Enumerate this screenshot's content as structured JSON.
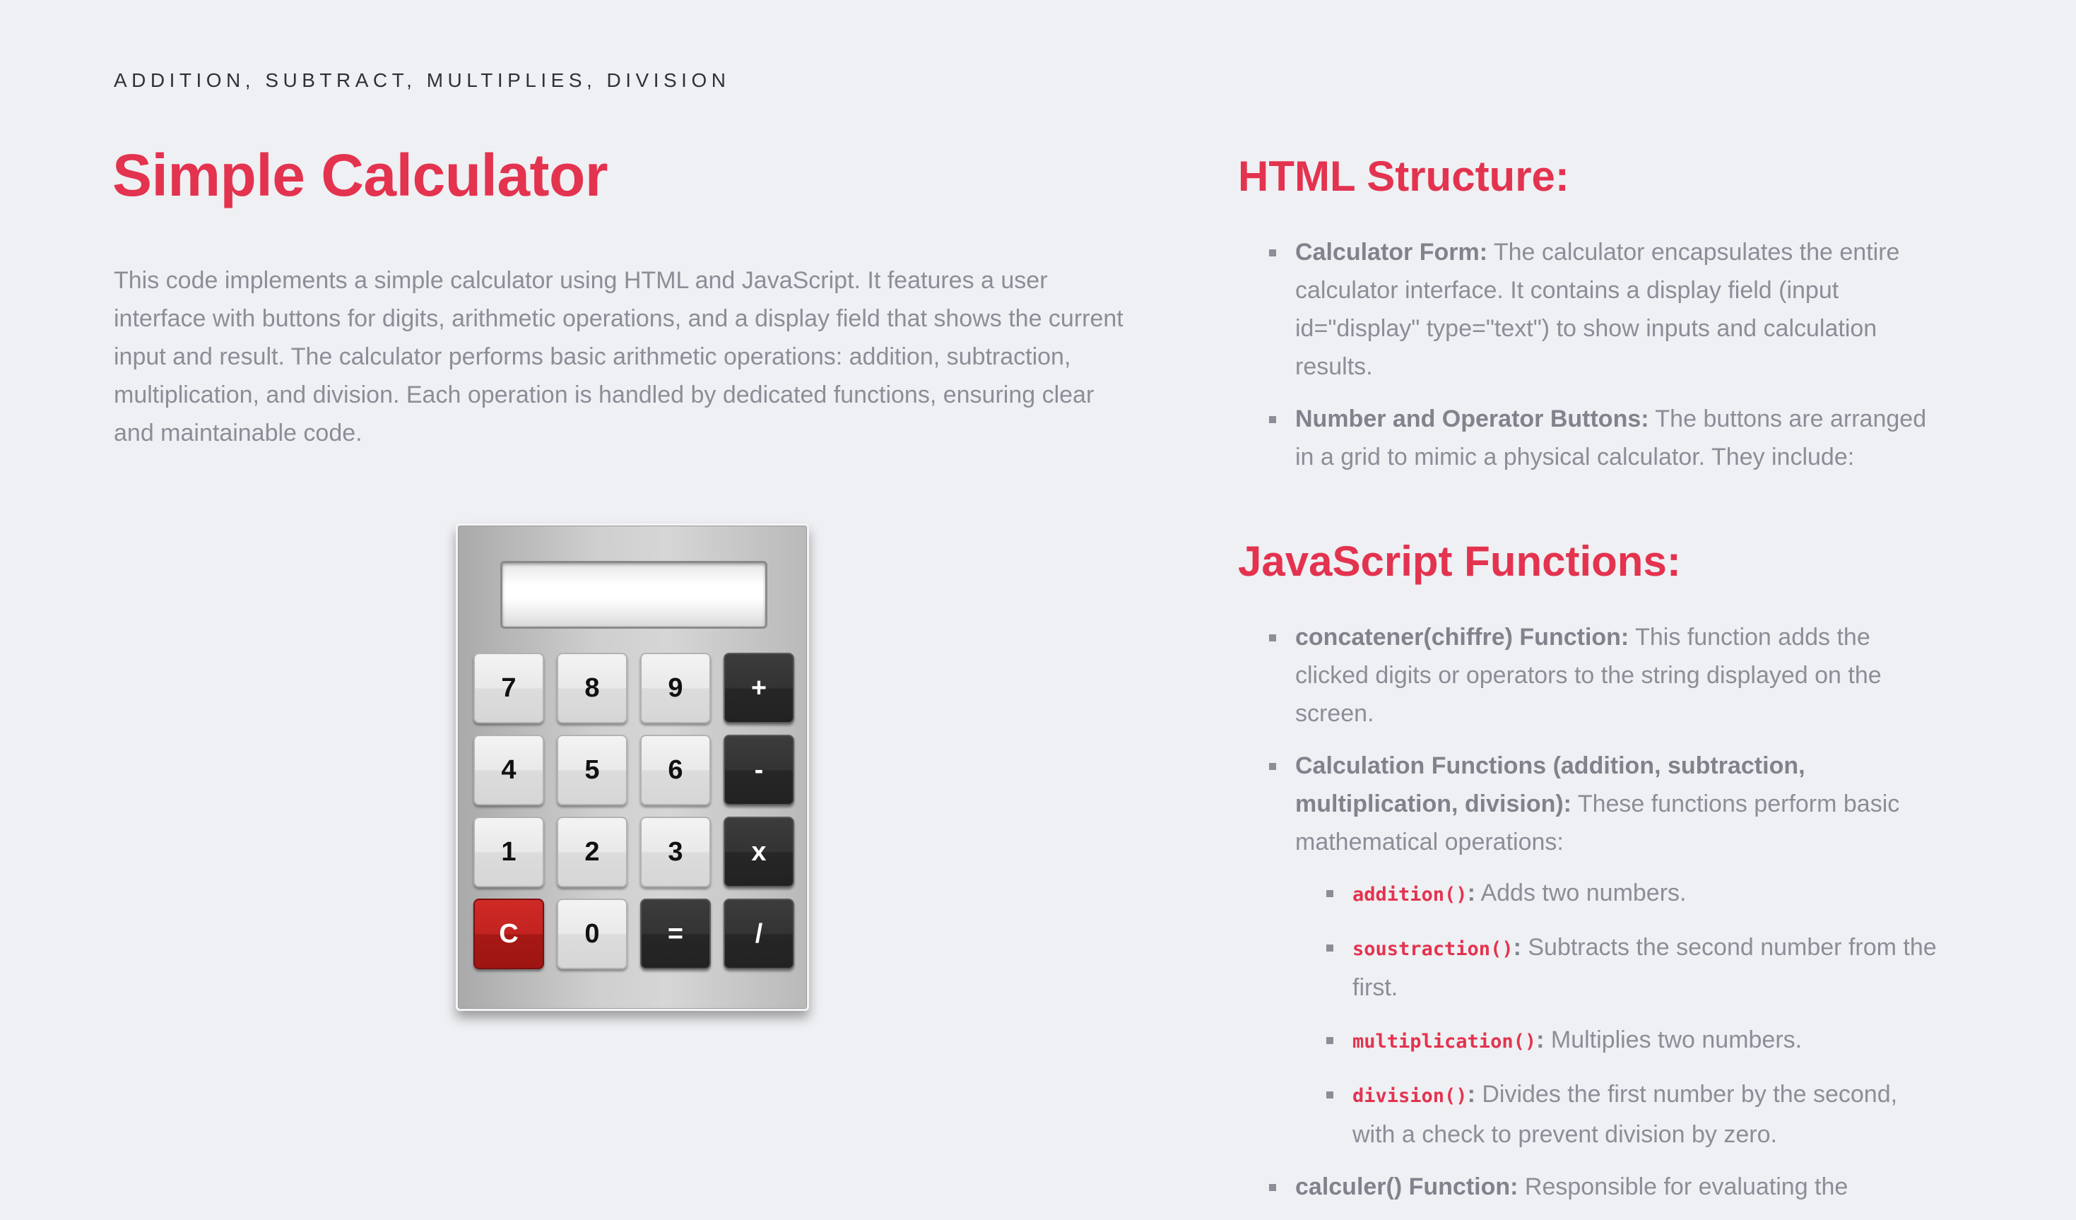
{
  "eyebrow": "ADDITION, SUBTRACT, MULTIPLIES, DIVISION",
  "title": "Simple Calculator",
  "intro": "This code implements a simple calculator using HTML and JavaScript. It features a user interface with buttons for digits, arithmetic operations, and a display field that shows the current input and result. The calculator performs basic arithmetic operations: addition, subtraction, multiplication, and division. Each operation is handled by dedicated functions, ensuring clear and maintainable code.",
  "calculator": {
    "display_value": "",
    "keys": [
      {
        "label": "7",
        "style": "light",
        "name": "key-7"
      },
      {
        "label": "8",
        "style": "light",
        "name": "key-8"
      },
      {
        "label": "9",
        "style": "light",
        "name": "key-9"
      },
      {
        "label": "+",
        "style": "dark",
        "name": "key-plus"
      },
      {
        "label": "4",
        "style": "light",
        "name": "key-4"
      },
      {
        "label": "5",
        "style": "light",
        "name": "key-5"
      },
      {
        "label": "6",
        "style": "light",
        "name": "key-6"
      },
      {
        "label": "-",
        "style": "dark",
        "name": "key-minus"
      },
      {
        "label": "1",
        "style": "light",
        "name": "key-1"
      },
      {
        "label": "2",
        "style": "light",
        "name": "key-2"
      },
      {
        "label": "3",
        "style": "light",
        "name": "key-3"
      },
      {
        "label": "x",
        "style": "dark",
        "name": "key-multiply"
      },
      {
        "label": "C",
        "style": "red",
        "name": "key-clear"
      },
      {
        "label": "0",
        "style": "light",
        "name": "key-0"
      },
      {
        "label": "=",
        "style": "dark",
        "name": "key-equals"
      },
      {
        "label": "/",
        "style": "dark",
        "name": "key-divide"
      }
    ]
  },
  "html_structure": {
    "title": "HTML Structure:",
    "items": [
      {
        "label": "Calculator Form:",
        "text": " The calculator encapsulates the entire calculator interface. It contains a display field (input id=\"display\" type=\"text\") to show inputs and calculation results."
      },
      {
        "label": "Number and Operator Buttons:",
        "text": " The buttons are arranged in a grid to mimic a physical calculator. They include:"
      }
    ]
  },
  "js_functions": {
    "title": "JavaScript Functions:",
    "items": [
      {
        "label": "concatener(chiffre) Function:",
        "text": " This function adds the clicked digits or operators to the string displayed on the screen."
      },
      {
        "label": "Calculation Functions (addition, subtraction, multiplication, division):",
        "text": " These functions perform basic mathematical operations:"
      },
      {
        "label": "calculer() Function:",
        "text": " Responsible for evaluating the"
      }
    ],
    "sub_items": [
      {
        "code": "addition()",
        "colon": ":",
        "text": " Adds two numbers."
      },
      {
        "code": "soustraction()",
        "colon": ":",
        "text": " Subtracts the second number from the first."
      },
      {
        "code": "multiplication()",
        "colon": ":",
        "text": " Multiplies two numbers."
      },
      {
        "code": "division()",
        "colon": ":",
        "text": " Divides the first number by the second, with a check to prevent division by zero."
      }
    ]
  }
}
